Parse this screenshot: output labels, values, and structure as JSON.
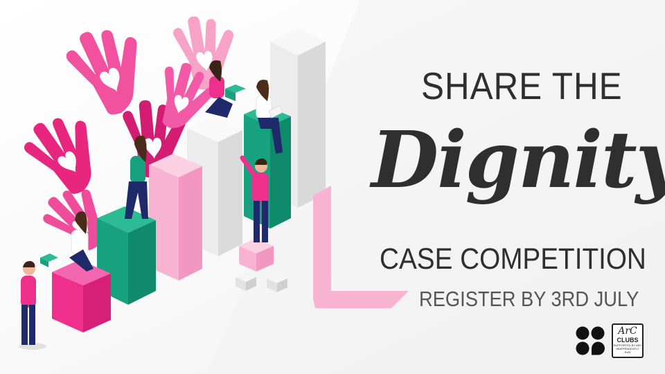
{
  "headline": {
    "line1": "SHARE THE",
    "line2": "Dignity",
    "line3": "CASE COMPETITION",
    "line4": "REGISTER BY 3RD JULY"
  },
  "logos": {
    "dots_logo": "four-dots-logo",
    "arc_logo": {
      "main": "ArC",
      "sub": "CLUBS",
      "small": "SUPPORTED BY ARC INDEPENDENTLY RUN"
    }
  },
  "colors": {
    "pink": "#ee2f8c",
    "light_pink": "#f7b3d1",
    "green": "#17a17f",
    "white_block": "#e9e9e9",
    "text": "#2f2f2f"
  }
}
